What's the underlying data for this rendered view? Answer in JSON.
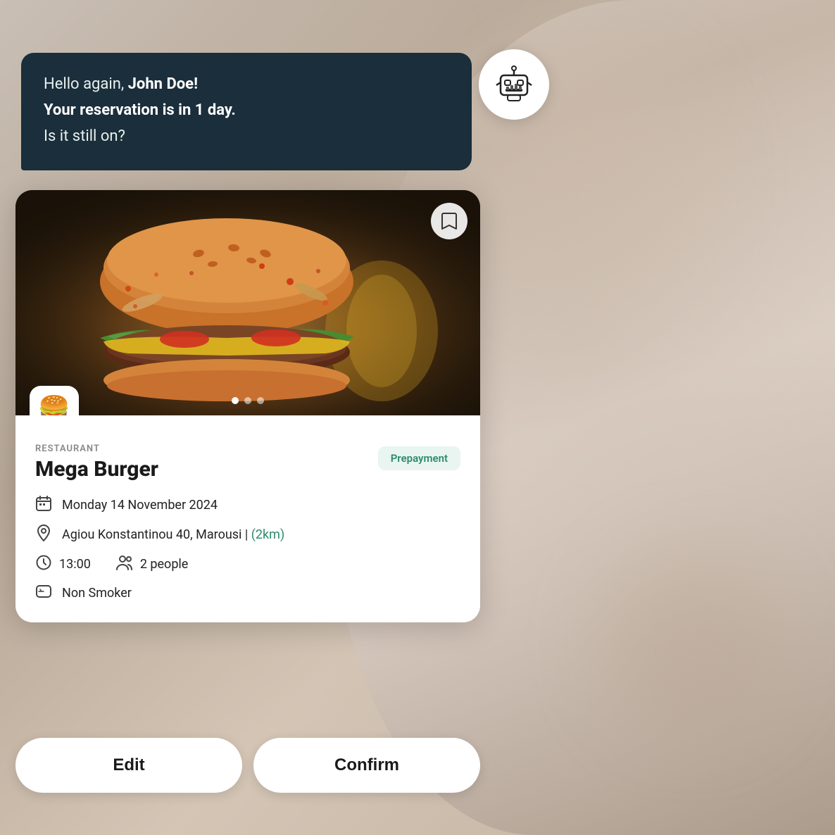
{
  "background": {
    "color": "#c9bfb5"
  },
  "chat_bubble": {
    "line1_plain": "Hello again, ",
    "line1_bold": "John Doe!",
    "line2": "Your reservation is in 1 day.",
    "line3": "Is it still on?"
  },
  "robot_avatar": {
    "label": "robot"
  },
  "card": {
    "category": "RESTAURANT",
    "name": "Mega Burger",
    "prepayment_label": "Prepayment",
    "date_icon": "📅",
    "date": "Monday 14 November 2024",
    "location_icon": "📍",
    "address": "Agiou Konstantinou 40, Marousi",
    "distance": "(2km)",
    "time_icon": "🕐",
    "time": "13:00",
    "people_icon": "👤",
    "people": "2 people",
    "smoke_icon": "💬",
    "smoke": "Non Smoker",
    "bookmark_icon": "🔖",
    "dots": [
      "active",
      "inactive",
      "inactive"
    ],
    "burger_emoji": "🍔"
  },
  "buttons": {
    "edit_label": "Edit",
    "confirm_label": "Confirm"
  }
}
